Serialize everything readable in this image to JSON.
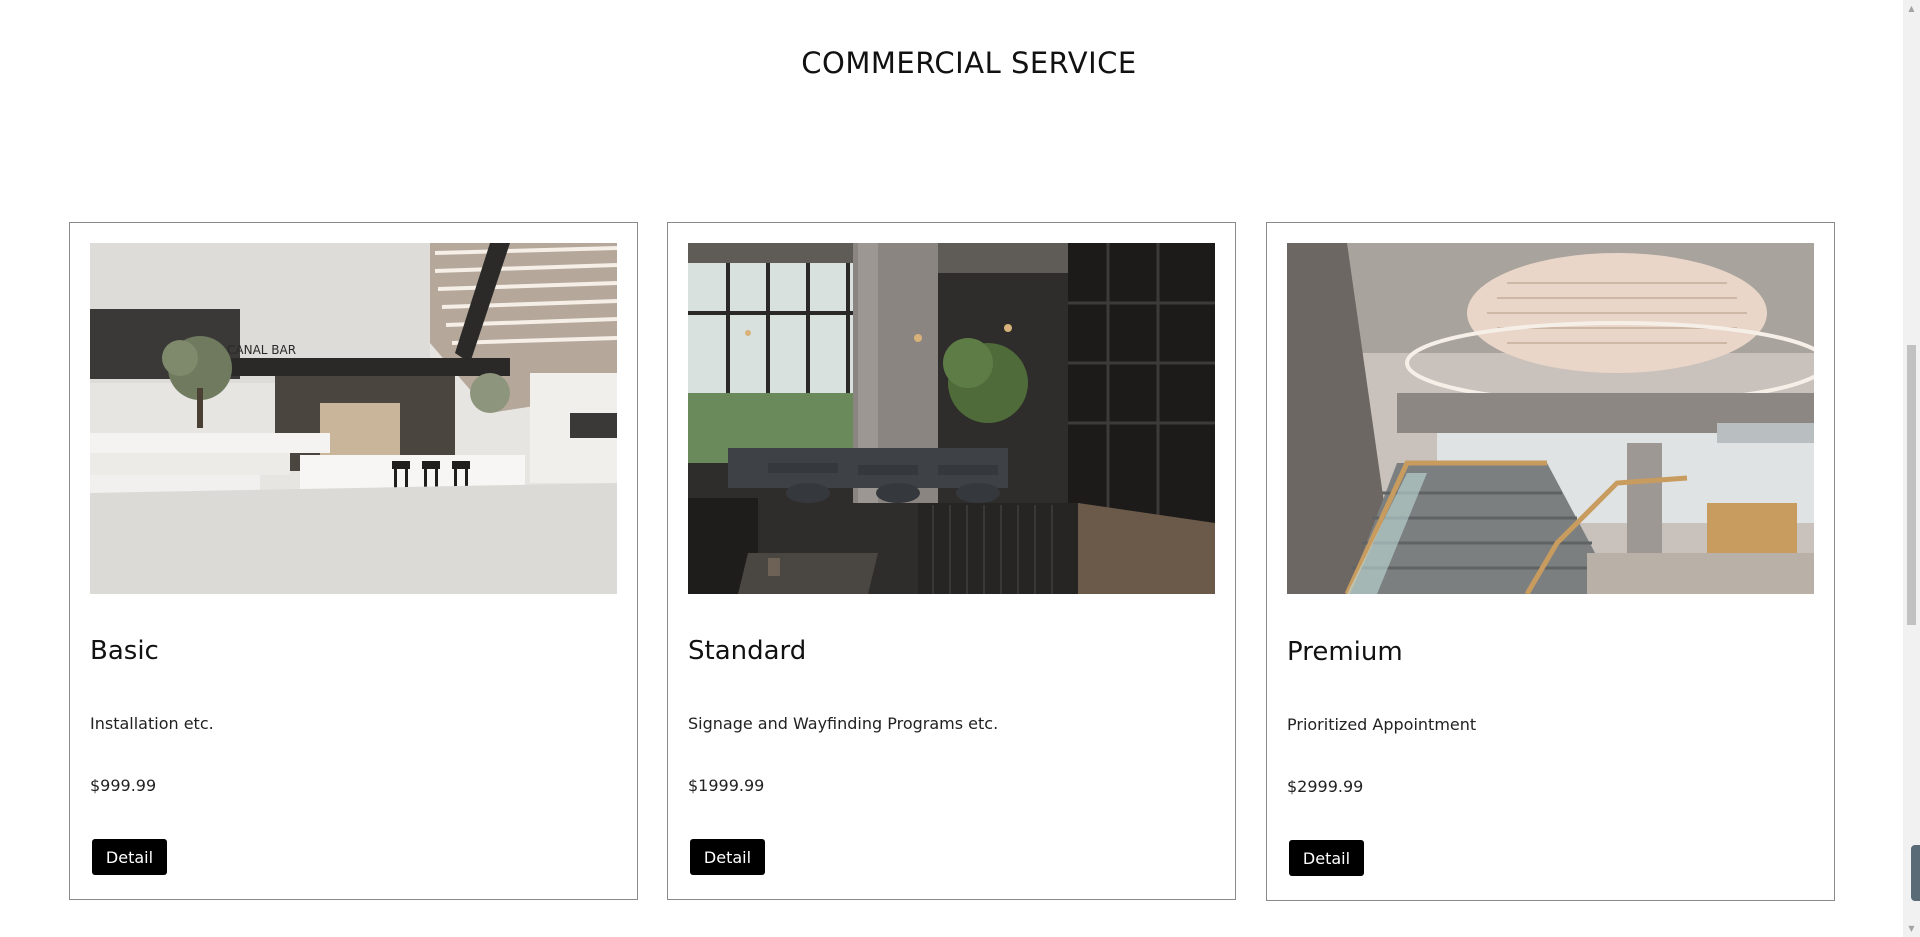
{
  "section": {
    "title": "COMMERCIAL SERVICE"
  },
  "cards": [
    {
      "image_alt": "Modern lobby with white stone stairs and a bar counter",
      "image_sign": "CANAL BAR",
      "title": "Basic",
      "description": "Installation etc.",
      "price": "$999.99",
      "button_label": "Detail"
    },
    {
      "image_alt": "Restaurant interior with concrete pillar, leather booths and plants",
      "title": "Standard",
      "description": "Signage and Wayfinding Programs etc.",
      "price": "$1999.99",
      "button_label": "Detail"
    },
    {
      "image_alt": "Office atrium with curved staircase and glass railings",
      "title": "Premium",
      "description": "Prioritized Appointment",
      "price": "$2999.99",
      "button_label": "Detail"
    }
  ],
  "scrollbar": {
    "up_icon": "scroll-up-arrow-icon",
    "down_icon": "scroll-down-arrow-icon"
  }
}
